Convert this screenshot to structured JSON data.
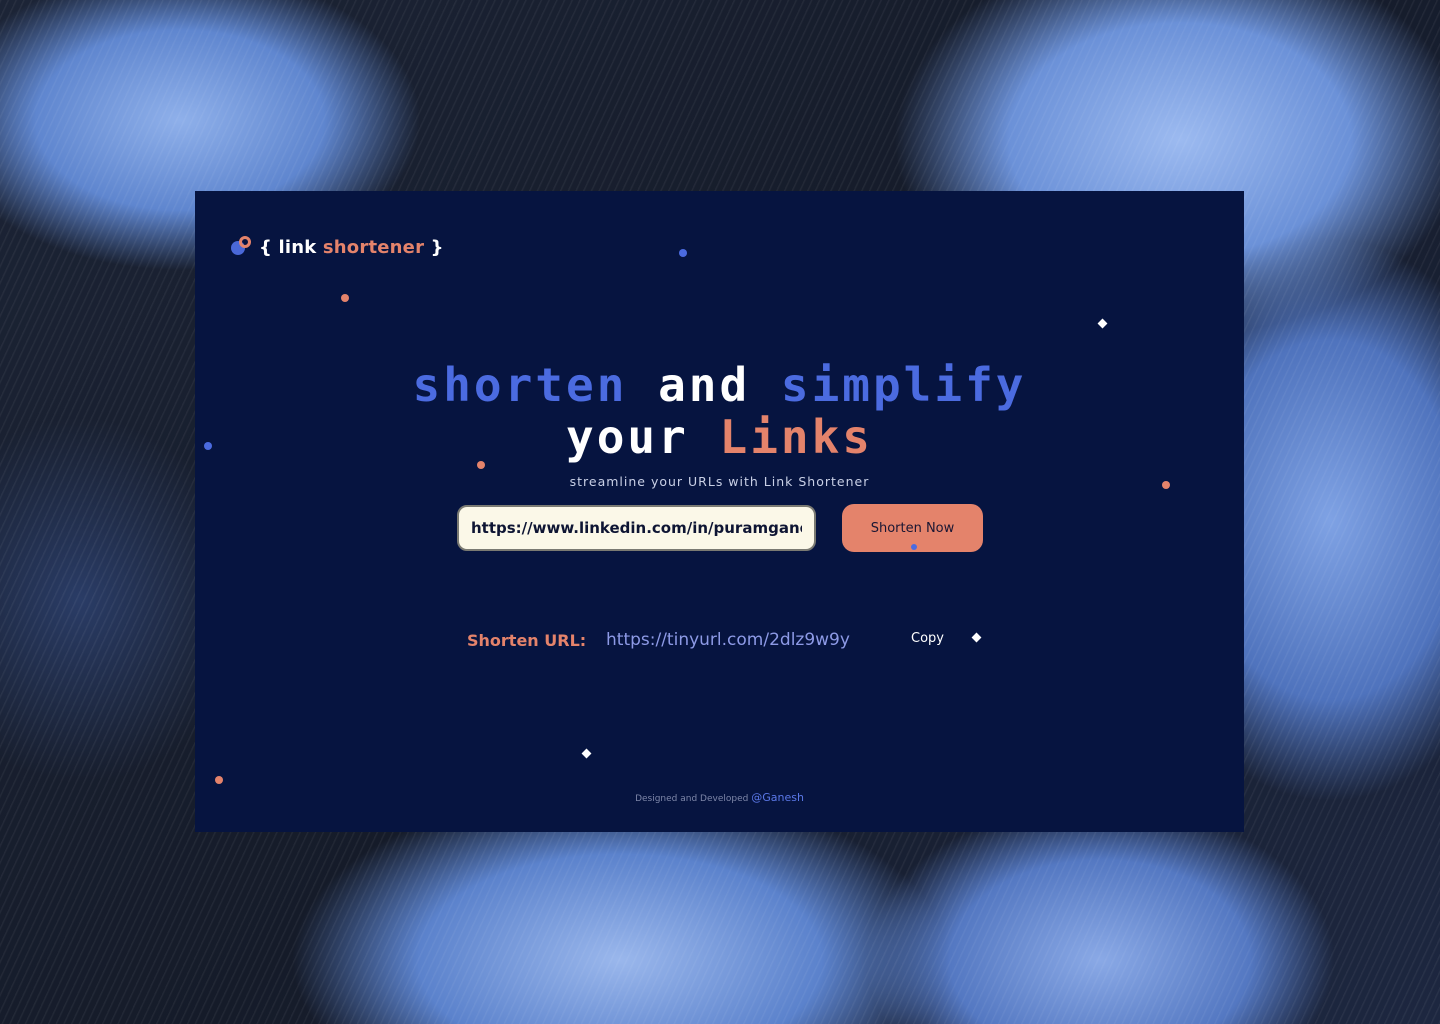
{
  "app": {
    "logo_prefix": "{ link",
    "logo_accent": "shortener",
    "logo_suffix": "}"
  },
  "hero": {
    "line1_part1": "shorten",
    "line1_part2": "and",
    "line1_part3": "simplify",
    "line2_part1": "your",
    "line2_part2": "Links",
    "subtitle": "streamline your URLs with Link Shortener"
  },
  "form": {
    "url_value": "https://www.linkedin.com/in/puramganesh/",
    "submit_label": "Shorten Now"
  },
  "result": {
    "label": "Shorten URL:",
    "short_url": "https://tinyurl.com/2dlz9w9y",
    "copy_label": "Copy"
  },
  "footer": {
    "text": "Designed and Developed",
    "author": "@Ganesh"
  },
  "colors": {
    "card_bg": "#061440",
    "accent_blue": "#4b6be0",
    "accent_orange": "#e4836b",
    "input_bg": "#fbf8e8"
  }
}
